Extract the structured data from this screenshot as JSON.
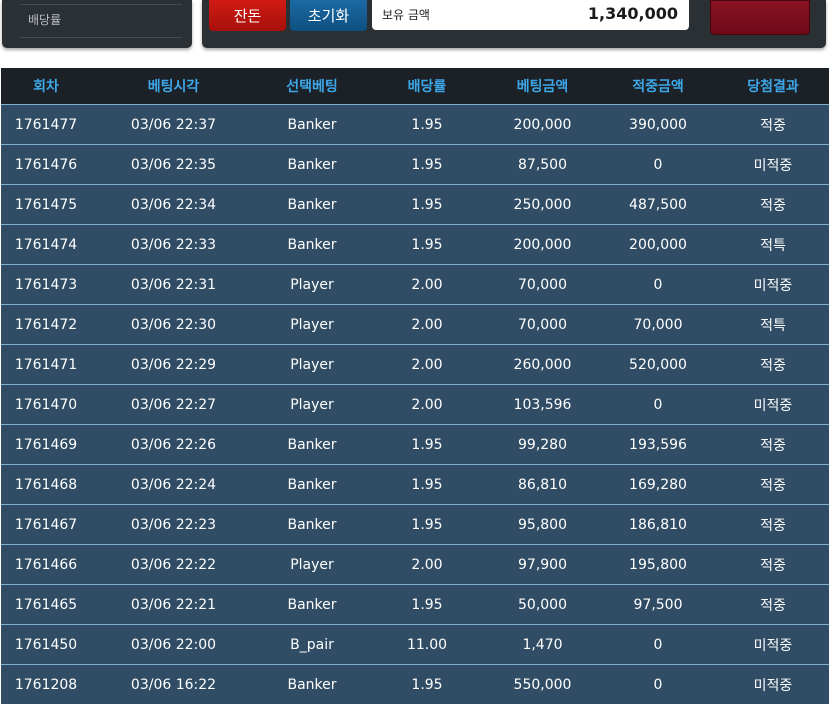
{
  "left_panel": {
    "label": "배당률"
  },
  "toolbar": {
    "red_button_label": "잔돈",
    "blue_button_label": "초기화",
    "balance_label": "보유 금액",
    "balance_value": "1,340,000"
  },
  "table": {
    "headers": [
      "회차",
      "베팅시각",
      "선택베팅",
      "배당률",
      "베팅금액",
      "적중금액",
      "당첨결과"
    ],
    "rows": [
      {
        "round": "1761477",
        "time": "03/06 22:37",
        "pick": "Banker",
        "odds": "1.95",
        "bet": "200,000",
        "payout": "390,000",
        "result": "적중",
        "status": "win"
      },
      {
        "round": "1761476",
        "time": "03/06 22:35",
        "pick": "Banker",
        "odds": "1.95",
        "bet": "87,500",
        "payout": "0",
        "result": "미적중",
        "status": "lose"
      },
      {
        "round": "1761475",
        "time": "03/06 22:34",
        "pick": "Banker",
        "odds": "1.95",
        "bet": "250,000",
        "payout": "487,500",
        "result": "적중",
        "status": "win"
      },
      {
        "round": "1761474",
        "time": "03/06 22:33",
        "pick": "Banker",
        "odds": "1.95",
        "bet": "200,000",
        "payout": "200,000",
        "result": "적특",
        "status": "win"
      },
      {
        "round": "1761473",
        "time": "03/06 22:31",
        "pick": "Player",
        "odds": "2.00",
        "bet": "70,000",
        "payout": "0",
        "result": "미적중",
        "status": "lose"
      },
      {
        "round": "1761472",
        "time": "03/06 22:30",
        "pick": "Player",
        "odds": "2.00",
        "bet": "70,000",
        "payout": "70,000",
        "result": "적특",
        "status": "win"
      },
      {
        "round": "1761471",
        "time": "03/06 22:29",
        "pick": "Player",
        "odds": "2.00",
        "bet": "260,000",
        "payout": "520,000",
        "result": "적중",
        "status": "win"
      },
      {
        "round": "1761470",
        "time": "03/06 22:27",
        "pick": "Player",
        "odds": "2.00",
        "bet": "103,596",
        "payout": "0",
        "result": "미적중",
        "status": "lose"
      },
      {
        "round": "1761469",
        "time": "03/06 22:26",
        "pick": "Banker",
        "odds": "1.95",
        "bet": "99,280",
        "payout": "193,596",
        "result": "적중",
        "status": "win"
      },
      {
        "round": "1761468",
        "time": "03/06 22:24",
        "pick": "Banker",
        "odds": "1.95",
        "bet": "86,810",
        "payout": "169,280",
        "result": "적중",
        "status": "win"
      },
      {
        "round": "1761467",
        "time": "03/06 22:23",
        "pick": "Banker",
        "odds": "1.95",
        "bet": "95,800",
        "payout": "186,810",
        "result": "적중",
        "status": "win"
      },
      {
        "round": "1761466",
        "time": "03/06 22:22",
        "pick": "Player",
        "odds": "2.00",
        "bet": "97,900",
        "payout": "195,800",
        "result": "적중",
        "status": "win"
      },
      {
        "round": "1761465",
        "time": "03/06 22:21",
        "pick": "Banker",
        "odds": "1.95",
        "bet": "50,000",
        "payout": "97,500",
        "result": "적중",
        "status": "win"
      },
      {
        "round": "1761450",
        "time": "03/06 22:00",
        "pick": "B_pair",
        "odds": "11.00",
        "bet": "1,470",
        "payout": "0",
        "result": "미적중",
        "status": "lose"
      },
      {
        "round": "1761208",
        "time": "03/06 16:22",
        "pick": "Banker",
        "odds": "1.95",
        "bet": "550,000",
        "payout": "0",
        "result": "미적중",
        "status": "lose"
      }
    ]
  },
  "colors": {
    "header_bg": "#1b2127",
    "header_text": "#3da7e8",
    "row_bg": "#304d65",
    "win": "#f0a31e",
    "lose": "#d51515"
  }
}
